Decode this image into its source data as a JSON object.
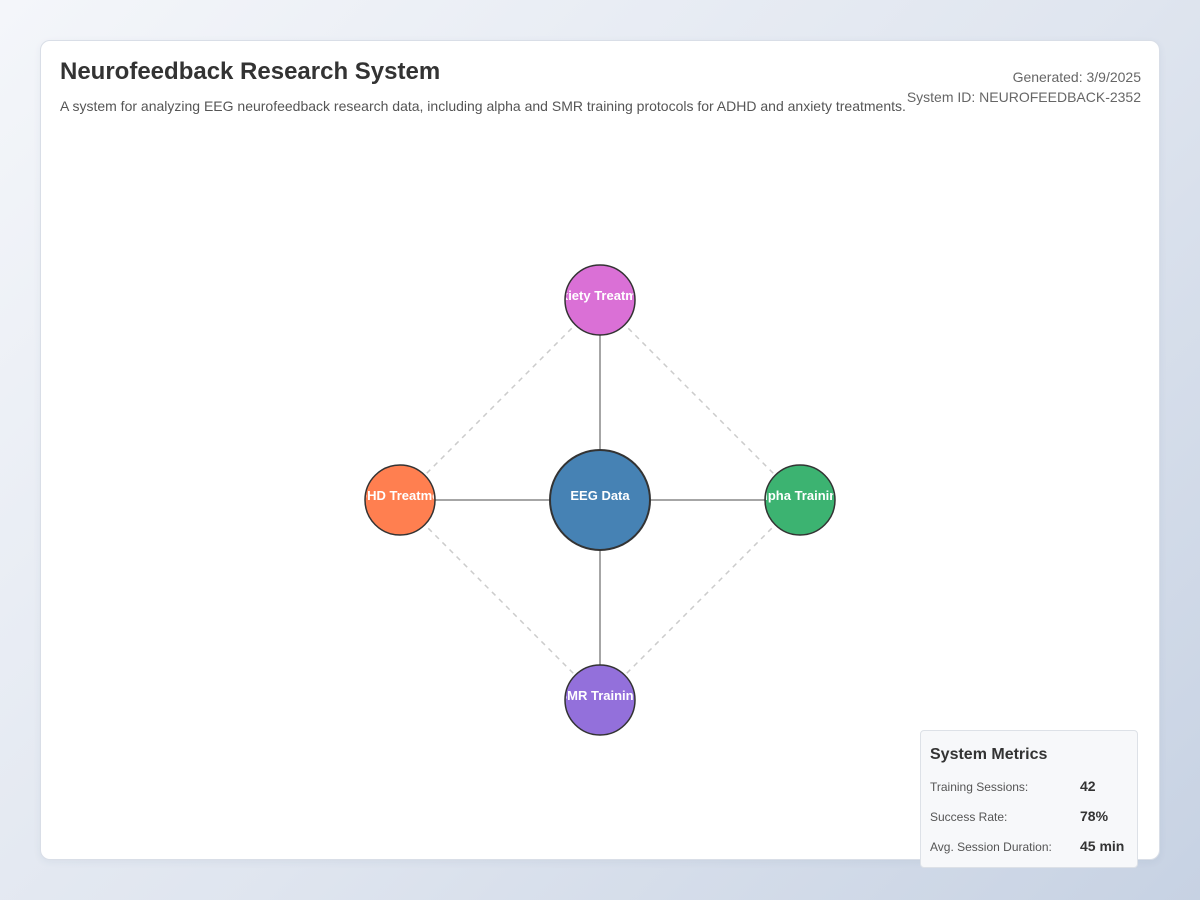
{
  "header": {
    "title": "Neurofeedback Research System",
    "description": "A system for analyzing EEG neurofeedback research data, including alpha and SMR training protocols for ADHD and anxiety treatments.",
    "generated": "Generated: 3/9/2025",
    "system_id": "System ID: NEUROFEEDBACK-2352"
  },
  "diagram": {
    "nodes": [
      {
        "id": "eeg",
        "label": "EEG Data",
        "color": "#4682b4",
        "role": "center"
      },
      {
        "id": "anxiety",
        "label": "Anxiety Treatment",
        "color": "#da70d6",
        "role": "top"
      },
      {
        "id": "adhd",
        "label": "ADHD Treatment",
        "color": "#ff7f50",
        "role": "left"
      },
      {
        "id": "alpha",
        "label": "Alpha Training",
        "color": "#3cb371",
        "role": "right"
      },
      {
        "id": "smr",
        "label": "SMR Training",
        "color": "#9370db",
        "role": "bottom"
      }
    ],
    "edges": [
      {
        "from": "eeg",
        "to": "anxiety",
        "style": "solid"
      },
      {
        "from": "eeg",
        "to": "adhd",
        "style": "solid"
      },
      {
        "from": "eeg",
        "to": "alpha",
        "style": "solid"
      },
      {
        "from": "eeg",
        "to": "smr",
        "style": "solid"
      },
      {
        "from": "anxiety",
        "to": "adhd",
        "style": "dashed"
      },
      {
        "from": "anxiety",
        "to": "alpha",
        "style": "dashed"
      },
      {
        "from": "adhd",
        "to": "smr",
        "style": "dashed"
      },
      {
        "from": "alpha",
        "to": "smr",
        "style": "dashed"
      }
    ]
  },
  "metrics": {
    "title": "System Metrics",
    "items": [
      {
        "label": "Training Sessions:",
        "value": "42"
      },
      {
        "label": "Success Rate:",
        "value": "78%"
      },
      {
        "label": "Avg. Session Duration:",
        "value": "45 min"
      }
    ]
  }
}
